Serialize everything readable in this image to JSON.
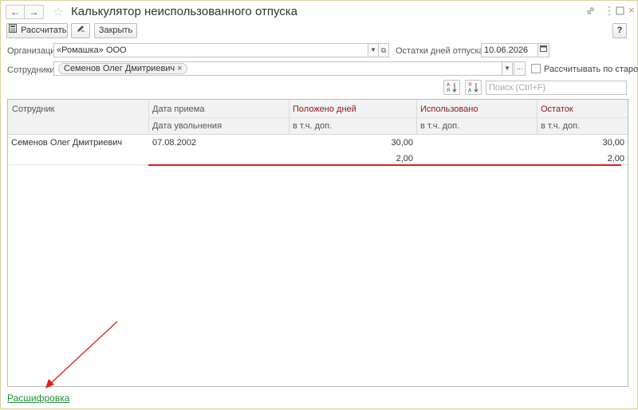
{
  "window": {
    "title": "Калькулятор неиспользованного отпуска",
    "nav_back": "🡐",
    "nav_forward": "🡒",
    "icons": [
      "link-icon",
      "more-icon",
      "maximize-icon",
      "close-icon"
    ]
  },
  "toolbar": {
    "calculate_label": "Рассчитать",
    "close_label": "Закрыть",
    "help_label": "?"
  },
  "form": {
    "organization_label": "Организация:",
    "organization_value": "«Ромашка» ООО",
    "vacation_balance_label": "Остатки дней отпуска на:",
    "vacation_balance_date": "10.06.2026",
    "employees_label": "Сотрудники:",
    "employee_chip": "Семенов Олег Дмитриевич",
    "old_calc_label": "Рассчитывать по старому",
    "old_calc_checked": false,
    "search_placeholder": "Поиск (Ctrl+F)"
  },
  "table": {
    "headers": {
      "employee": "Сотрудник",
      "hire_date": "Дата приема",
      "dismissal_date": "Дата увольнения",
      "entitled_days": "Положено дней",
      "entitled_sub": "в т.ч. доп.",
      "used": "Использовано",
      "used_sub": "в т.ч. доп.",
      "balance": "Остаток",
      "balance_sub": "в т.ч. доп."
    },
    "rows": [
      {
        "employee": "Семенов Олег Дмитриевич",
        "hire_date": "07.08.2002",
        "dismissal_date": "",
        "entitled": "30,00",
        "entitled_extra": "2,00",
        "used": "",
        "used_extra": "",
        "balance": "30,00",
        "balance_extra": "2,00"
      }
    ]
  },
  "footer": {
    "details_link": "Расшифровка"
  },
  "colors": {
    "link_green": "#1d8f3a",
    "header_red": "#8b1a1a",
    "annotation_red": "#e41b1b"
  }
}
